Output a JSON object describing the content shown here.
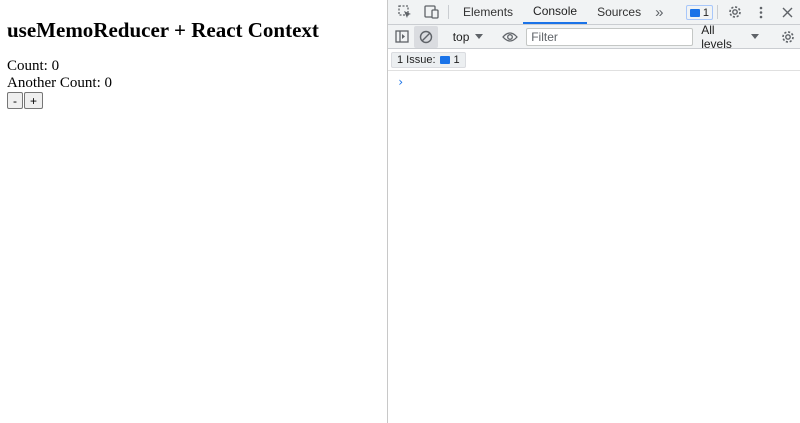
{
  "app": {
    "heading": "useMemoReducer + React Context",
    "count_text": "Count: 0",
    "another_count_text": "Another Count: 0",
    "decrement_label": "-",
    "increment_label": "+"
  },
  "devtools": {
    "tabs": [
      {
        "label": "Elements"
      },
      {
        "label": "Console"
      },
      {
        "label": "Sources"
      }
    ],
    "more_tabs_glyph": "»",
    "messages_badge_count": "1",
    "context_value": "top",
    "filter_placeholder": "Filter",
    "levels_label": "All levels",
    "issues_label": "1 Issue:",
    "issues_count": "1",
    "prompt_glyph": "›",
    "accent_color": "#1a73e8"
  }
}
